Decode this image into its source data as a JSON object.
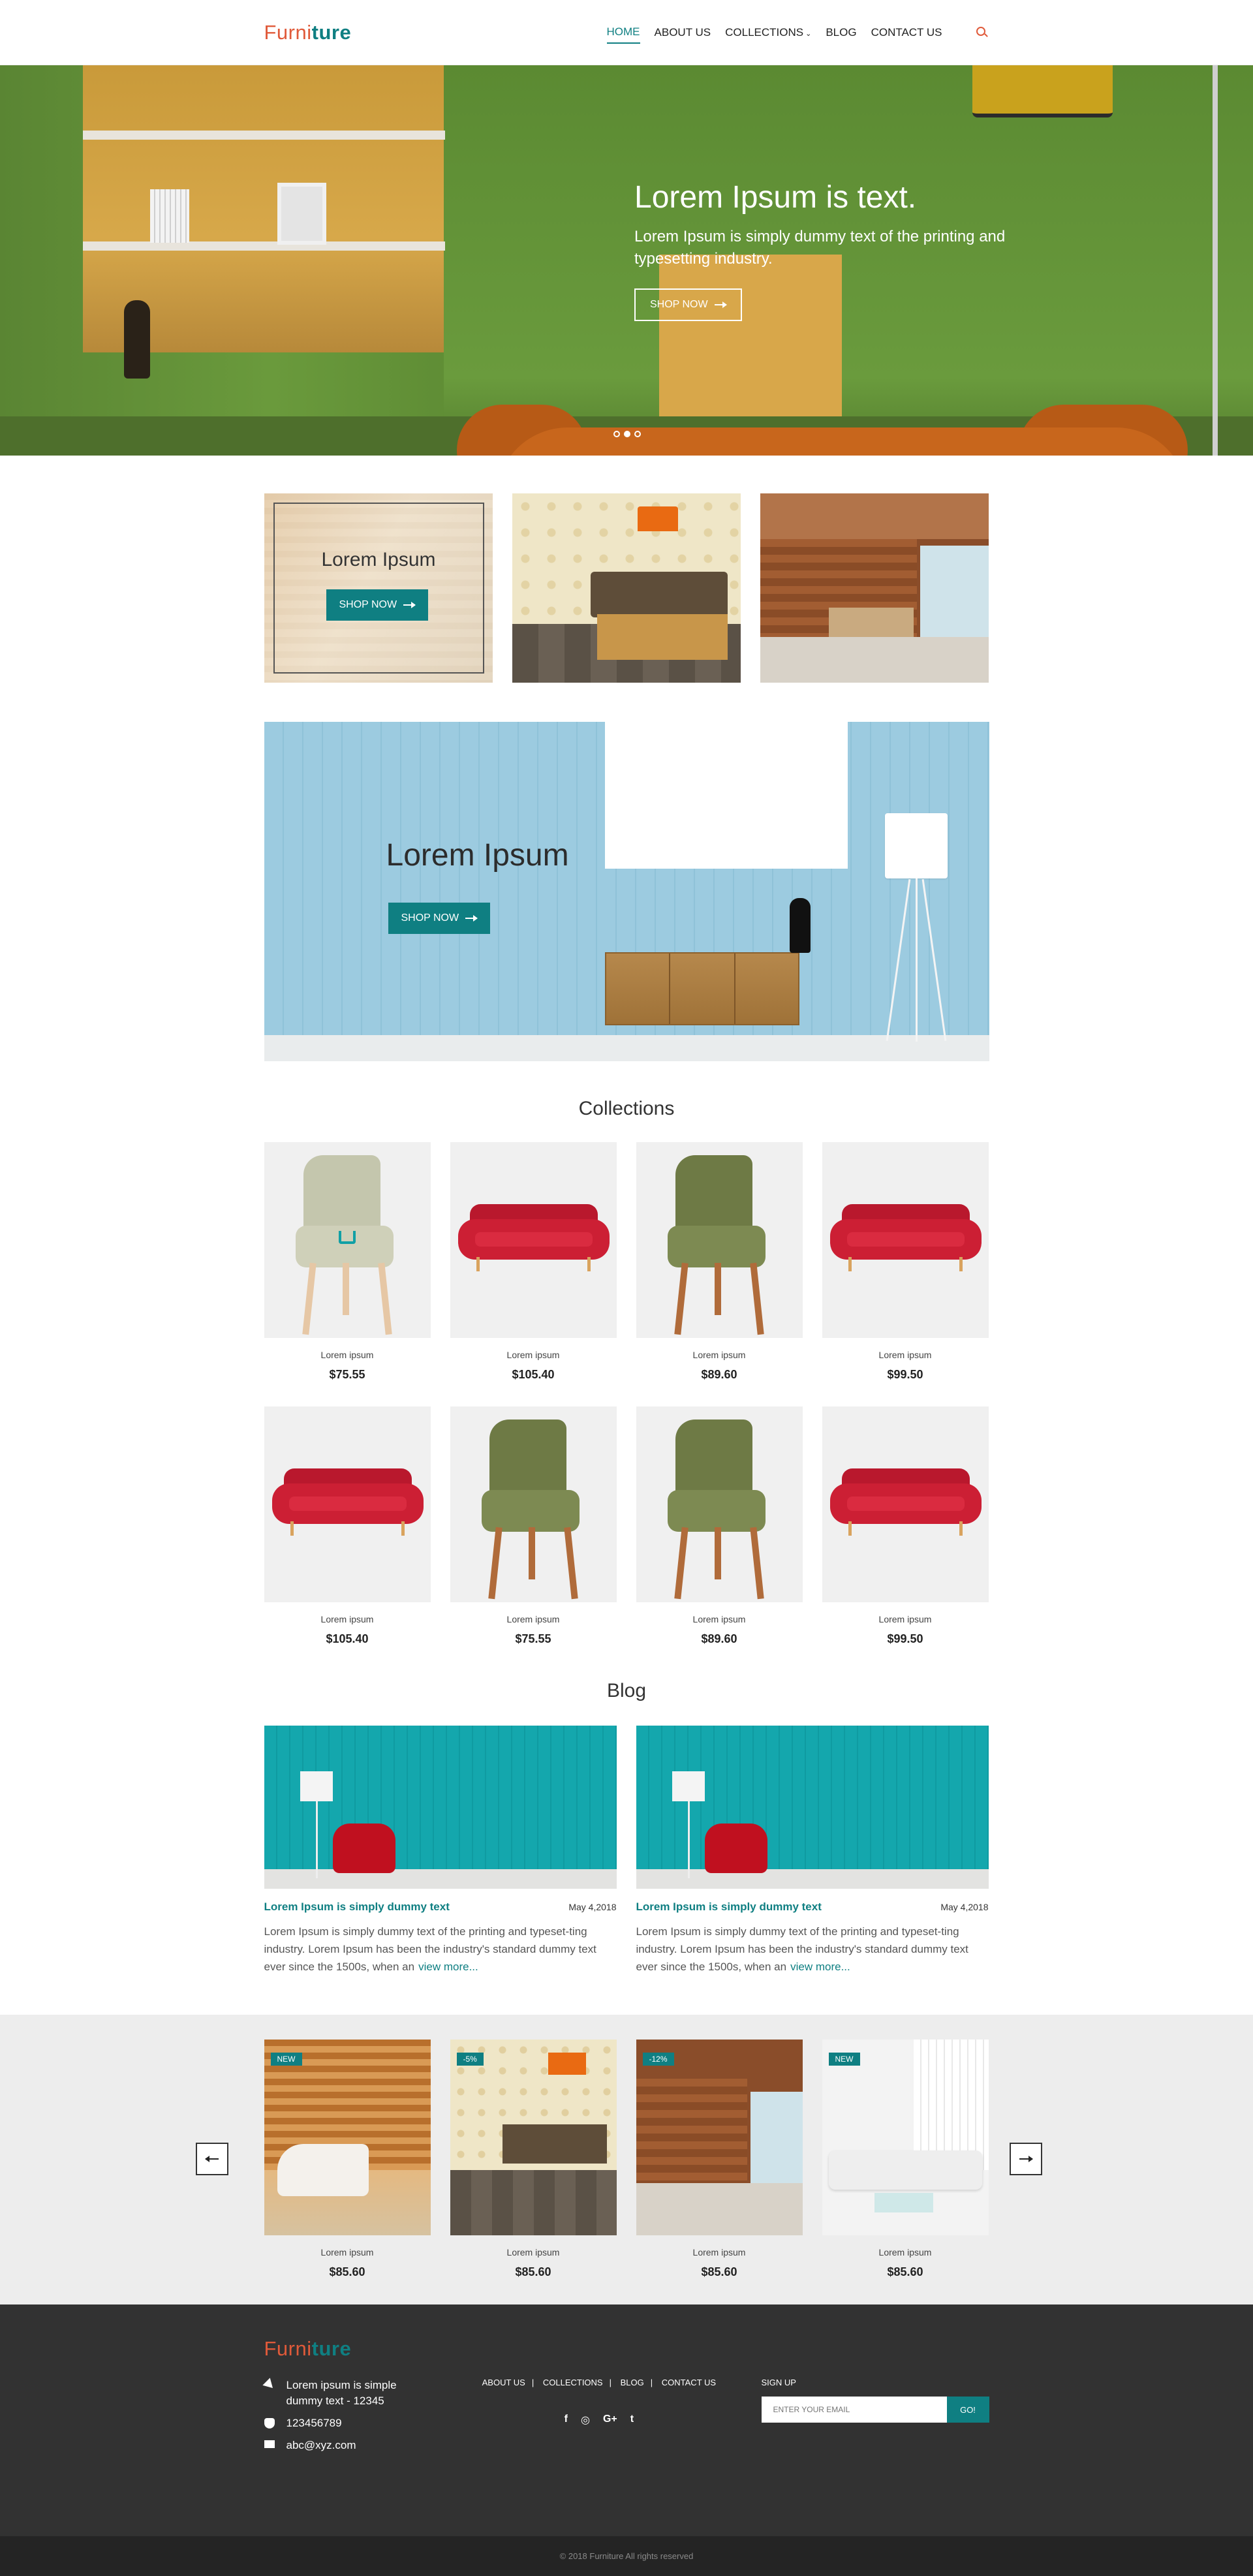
{
  "header": {
    "logo_a": "Furni",
    "logo_b": "ture",
    "nav": [
      "HOME",
      "ABOUT US",
      "COLLECTIONS",
      "BLOG",
      "CONTACT US"
    ]
  },
  "hero": {
    "title": "Lorem Ipsum is text.",
    "text": "Lorem Ipsum is simply dummy text of the printing and typesetting industry.",
    "button": "SHOP NOW",
    "active_slide": 2
  },
  "tile": {
    "title": "Lorem Ipsum",
    "button": "SHOP NOW"
  },
  "banner": {
    "title": "Lorem Ipsum",
    "button": "SHOP NOW"
  },
  "collections": {
    "title": "Collections",
    "items": [
      {
        "name": "Lorem ipsum",
        "price": "$75.55",
        "kind": "chair-light"
      },
      {
        "name": "Lorem ipsum",
        "price": "$105.40",
        "kind": "sofa"
      },
      {
        "name": "Lorem ipsum",
        "price": "$89.60",
        "kind": "chair"
      },
      {
        "name": "Lorem ipsum",
        "price": "$99.50",
        "kind": "sofa"
      },
      {
        "name": "Lorem ipsum",
        "price": "$105.40",
        "kind": "sofa"
      },
      {
        "name": "Lorem ipsum",
        "price": "$75.55",
        "kind": "chair"
      },
      {
        "name": "Lorem ipsum",
        "price": "$89.60",
        "kind": "chair"
      },
      {
        "name": "Lorem ipsum",
        "price": "$99.50",
        "kind": "sofa"
      }
    ]
  },
  "blog": {
    "title": "Blog",
    "posts": [
      {
        "title": "Lorem Ipsum is simply dummy text",
        "date": "May 4,2018",
        "text": "Lorem Ipsum is simply dummy text of the printing and typeset-ting industry. Lorem Ipsum has been the industry's standard dummy text ever since the 1500s, when an",
        "link": "view more..."
      },
      {
        "title": "Lorem Ipsum is simply dummy text",
        "date": "May 4,2018",
        "text": "Lorem Ipsum is simply dummy text of the printing and typeset-ting industry. Lorem Ipsum has been the industry's standard dummy text ever since the 1500s, when an",
        "link": "view more..."
      }
    ]
  },
  "featured": {
    "items": [
      {
        "badge": "NEW",
        "name": "Lorem ipsum",
        "price": "$85.60"
      },
      {
        "badge": "-5%",
        "name": "Lorem ipsum",
        "price": "$85.60"
      },
      {
        "badge": "-12%",
        "name": "Lorem ipsum",
        "price": "$85.60"
      },
      {
        "badge": "NEW",
        "name": "Lorem ipsum",
        "price": "$85.60"
      }
    ]
  },
  "footer": {
    "logo_a": "Furni",
    "logo_b": "ture",
    "address": "Lorem ipsum is simple dummy text - 12345",
    "phone": "123456789",
    "email": "abc@xyz.com",
    "links": [
      "ABOUT US",
      "COLLECTIONS",
      "BLOG",
      "CONTACT US"
    ],
    "social": [
      "f",
      "◎",
      "G+",
      "t"
    ],
    "signup_label": "SIGN UP",
    "email_placeholder": "ENTER YOUR EMAIL",
    "go": "GO!",
    "copyright": "© 2018 Furniture All rights reserved"
  },
  "colors": {
    "accent": "#0f7f82",
    "logo_orange": "#e05a3a",
    "footer": "#323232"
  }
}
